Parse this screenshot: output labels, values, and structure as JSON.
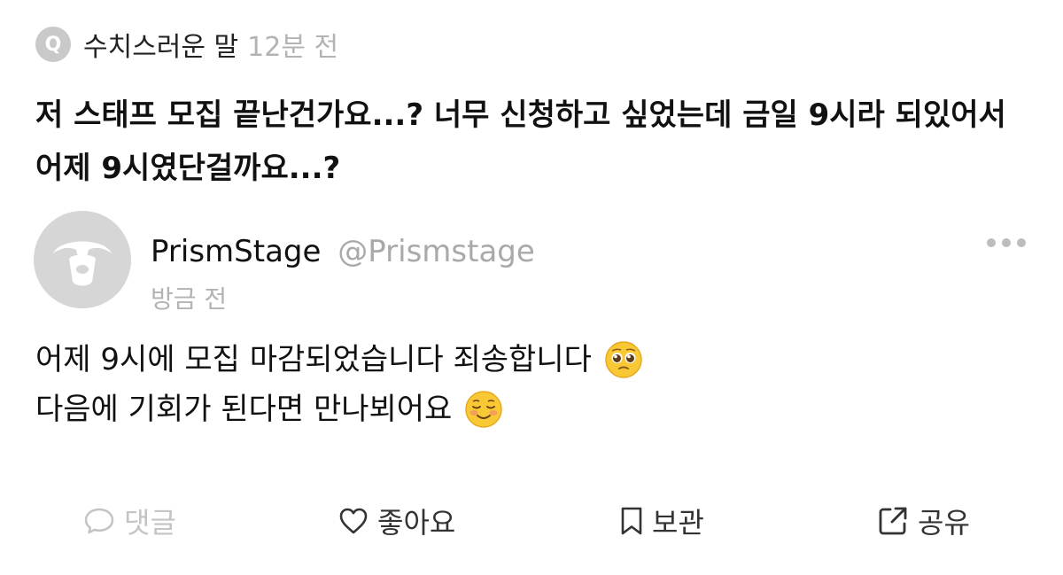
{
  "question": {
    "badge_letter": "Q",
    "asker_name": "수치스러운 말",
    "time": "12분 전",
    "text": "저 스태프 모집 끝난건가요...? 너무 신청하고 싶었는데 금일 9시라 되있어서 어제 9시였단걸까요...?"
  },
  "answer": {
    "author_name": "PrismStage",
    "author_handle": "@Prismstage",
    "time": "방금 전",
    "lines": [
      {
        "text": "어제 9시에 모집 마감되었습니다 죄송합니다",
        "emoji": "pleading-face-icon"
      },
      {
        "text": "다음에 기회가 된다면 만나뵈어요",
        "emoji": "smiling-face-icon"
      }
    ],
    "more_icon": "more-horizontal-icon"
  },
  "actions": {
    "comment": {
      "label": "댓글",
      "icon": "speech-bubble-icon",
      "color": "#c4c4c4"
    },
    "like": {
      "label": "좋아요",
      "icon": "heart-icon",
      "color": "#333333"
    },
    "save": {
      "label": "보관",
      "icon": "bookmark-icon",
      "color": "#333333"
    },
    "share": {
      "label": "공유",
      "icon": "share-icon",
      "color": "#333333"
    }
  },
  "colors": {
    "muted_text": "#b3b3b3",
    "badge_gray": "#c9c9c9",
    "avatar_gray": "#d9d9d9"
  }
}
